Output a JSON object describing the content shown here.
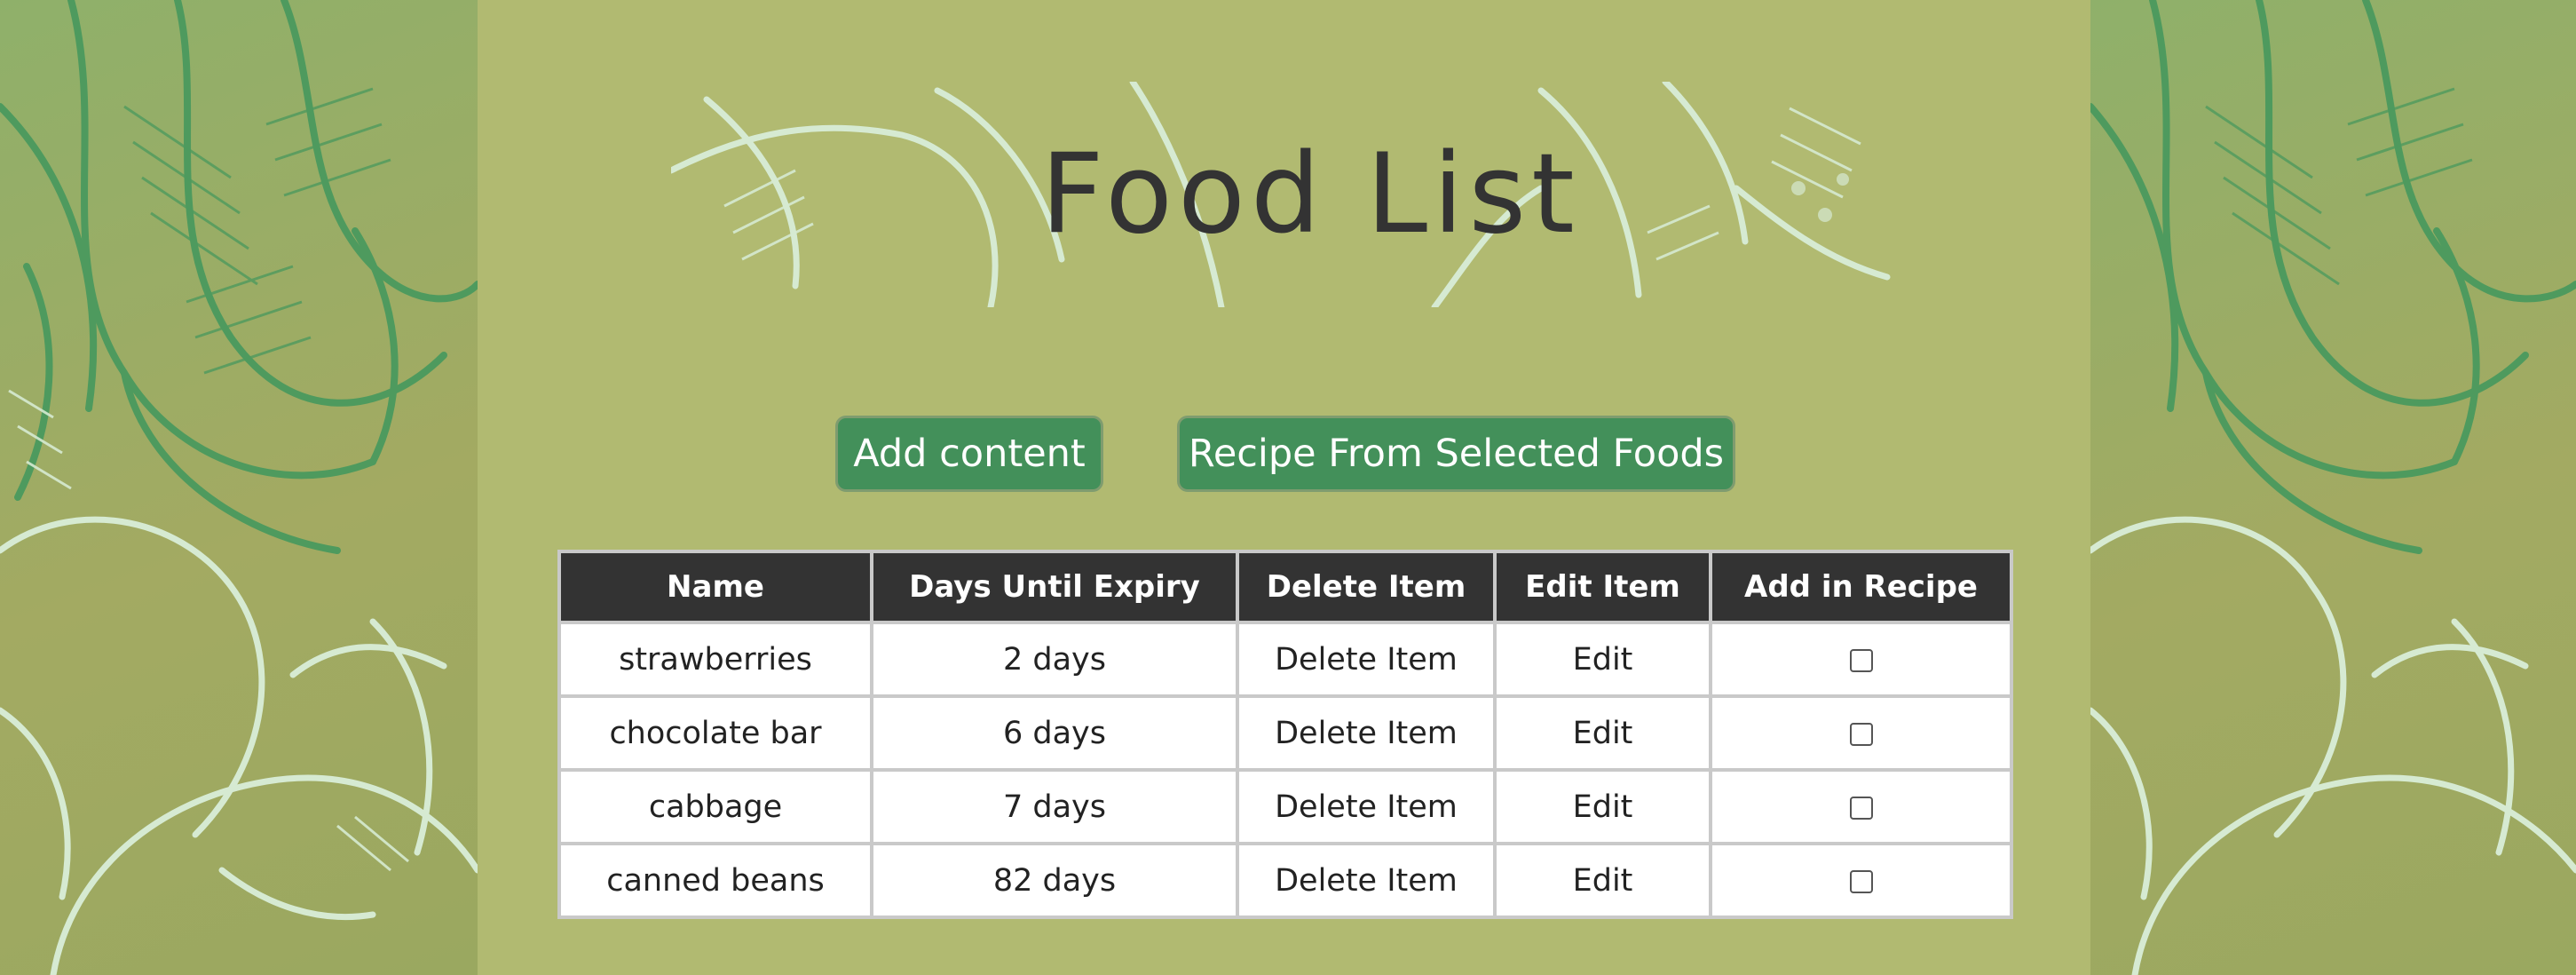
{
  "header": {
    "title": "Food List"
  },
  "actions": {
    "add_label": "Add content",
    "recipe_label": "Recipe From Selected Foods"
  },
  "table": {
    "columns": [
      "Name",
      "Days Until Expiry",
      "Delete Item",
      "Edit Item",
      "Add in Recipe"
    ],
    "rows": [
      {
        "name": "strawberries",
        "days": "2 days",
        "delete": "Delete Item",
        "edit": "Edit",
        "selected": false
      },
      {
        "name": "chocolate bar",
        "days": "6 days",
        "delete": "Delete Item",
        "edit": "Edit",
        "selected": false
      },
      {
        "name": "cabbage",
        "days": "7 days",
        "delete": "Delete Item",
        "edit": "Edit",
        "selected": false
      },
      {
        "name": "canned beans",
        "days": "82 days",
        "delete": "Delete Item",
        "edit": "Edit",
        "selected": false
      }
    ]
  },
  "colors": {
    "page_background": "#b1ba71",
    "button": "#43905a",
    "header_row": "#333333",
    "decoration_green": "#4e9a5e",
    "decoration_light": "#d6ead2"
  },
  "icons": {
    "side_art": "vegetable-sketch-art",
    "banner_art": "food-sketch-art"
  }
}
